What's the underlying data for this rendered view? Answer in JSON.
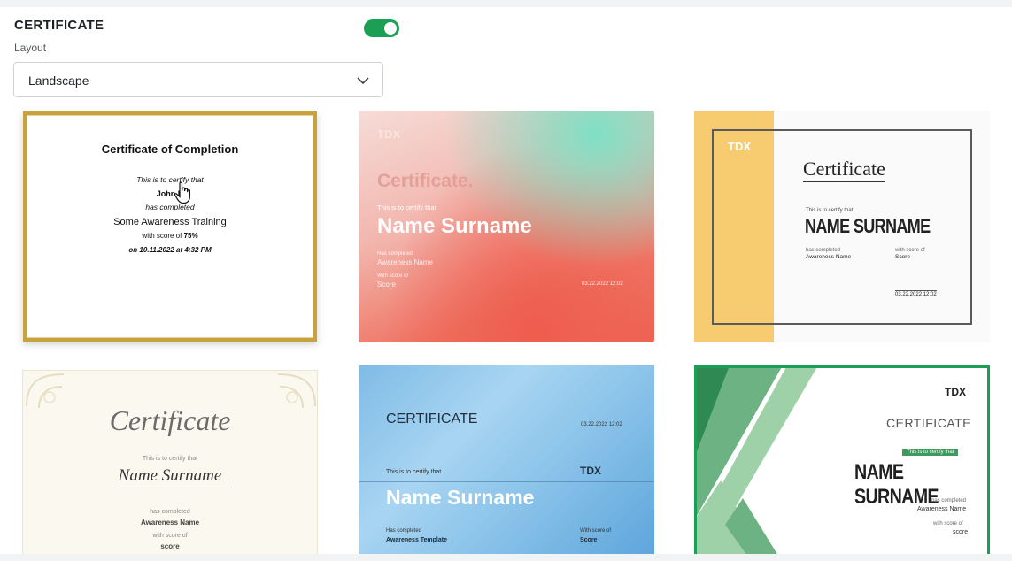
{
  "section": {
    "title": "CERTIFICATE",
    "toggle_on": true
  },
  "layout": {
    "label": "Layout",
    "selected": "Landscape"
  },
  "templates": [
    {
      "title": "Certificate of Completion",
      "certify": "This is to certify that",
      "name": "John D",
      "completed": "has completed",
      "course": "Some Awareness Training",
      "score_prefix": "with score of",
      "score": "75%",
      "date": "on 10.11.2022 at 4:32 PM"
    },
    {
      "brand": "TDX",
      "title": "Certificate.",
      "certify": "This is to certify that",
      "name": "Name Surname",
      "completed": "Has completed",
      "course": "Awareness Name",
      "score_label": "With score of",
      "score": "Score",
      "date": "03.22.2022  12:02"
    },
    {
      "brand": "TDX",
      "title": "Certificate",
      "certify": "This is to certify that",
      "name": "NAME SURNAME",
      "completed": "has completed",
      "course": "Awareness Name",
      "score_label": "with score of",
      "score": "Score",
      "date": "03.22.2022  12:02"
    },
    {
      "title": "Certificate",
      "certify": "This is to certify that",
      "name": "Name Surname",
      "completed": "has completed",
      "course": "Awareness Name",
      "score_label": "with score of",
      "score": "score"
    },
    {
      "title": "CERTIFICATE",
      "date": "03.22.2022  12:02",
      "certify": "This is to certify that",
      "brand": "TDX",
      "name": "Name Surname",
      "completed": "Has completed",
      "course": "Awareness Template",
      "score_label": "With score of",
      "score": "Score"
    },
    {
      "brand": "TDX",
      "title": "CERTIFICATE",
      "certify": "This is to certify that",
      "name": "NAME SURNAME",
      "completed": "has completed",
      "course": "Awareness Name",
      "score_label": "with score of",
      "score": "score"
    }
  ]
}
